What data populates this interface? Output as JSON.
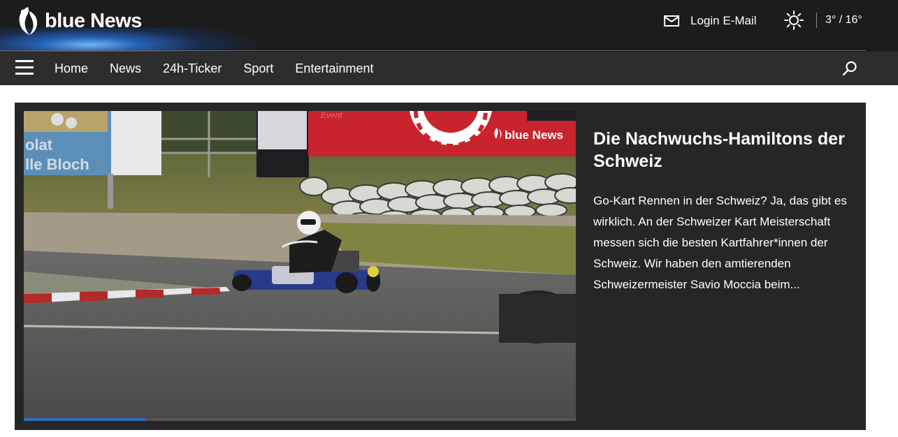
{
  "header": {
    "brand": "blue News",
    "login_label": "Login E-Mail",
    "temperature": "3° / 16°",
    "weather_icon": "sun-icon",
    "accent_color": "#2f6fc0"
  },
  "nav": {
    "items": [
      {
        "label": "Home"
      },
      {
        "label": "News"
      },
      {
        "label": "24h-Ticker"
      },
      {
        "label": "Sport"
      },
      {
        "label": "Entertainment"
      }
    ],
    "menu_icon": "hamburger-icon",
    "search_icon": "search-icon"
  },
  "teaser": {
    "headline": "Die Nachwuchs-Hamiltons der Schweiz",
    "text": "Go-Kart Rennen in der Schweiz? Ja, das gibt es wirklich. An der Schweizer Kart Meisterschaft messen sich die besten Kartfahrer*innen der Schweiz. Wir haben den amtierenden Schweizermeister Savio Moccia beim...",
    "media": {
      "banner_brand": "blue News",
      "sign_text_1": "olat",
      "sign_text_2": "lle Bloch",
      "banner_small_text": "Event",
      "progress_fraction": 0.22
    }
  }
}
